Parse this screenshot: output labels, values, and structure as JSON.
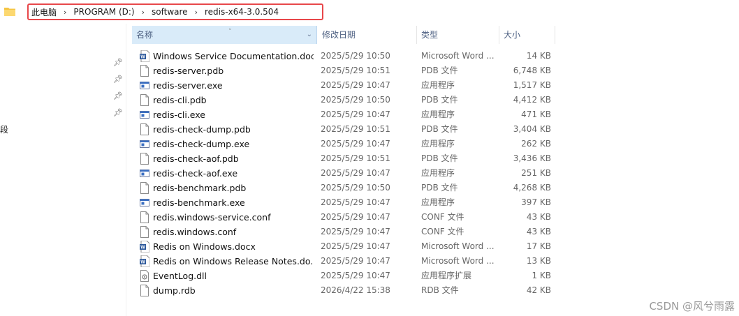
{
  "breadcrumb": [
    "此电脑",
    "PROGRAM (D:)",
    "software",
    "redis-x64-3.0.504"
  ],
  "nav_fragment": "段",
  "columns": {
    "name": "名称",
    "date": "修改日期",
    "type": "类型",
    "size": "大小"
  },
  "files": [
    {
      "name": "Windows Service Documentation.docx",
      "date": "2025/5/29 10:50",
      "type": "Microsoft Word ...",
      "size": "14 KB",
      "icon": "word-doc-icon"
    },
    {
      "name": "redis-server.pdb",
      "date": "2025/5/29 10:51",
      "type": "PDB 文件",
      "size": "6,748 KB",
      "icon": "file-icon"
    },
    {
      "name": "redis-server.exe",
      "date": "2025/5/29 10:47",
      "type": "应用程序",
      "size": "1,517 KB",
      "icon": "exe-icon"
    },
    {
      "name": "redis-cli.pdb",
      "date": "2025/5/29 10:50",
      "type": "PDB 文件",
      "size": "4,412 KB",
      "icon": "file-icon"
    },
    {
      "name": "redis-cli.exe",
      "date": "2025/5/29 10:47",
      "type": "应用程序",
      "size": "471 KB",
      "icon": "exe-icon"
    },
    {
      "name": "redis-check-dump.pdb",
      "date": "2025/5/29 10:51",
      "type": "PDB 文件",
      "size": "3,404 KB",
      "icon": "file-icon"
    },
    {
      "name": "redis-check-dump.exe",
      "date": "2025/5/29 10:47",
      "type": "应用程序",
      "size": "262 KB",
      "icon": "exe-icon"
    },
    {
      "name": "redis-check-aof.pdb",
      "date": "2025/5/29 10:51",
      "type": "PDB 文件",
      "size": "3,436 KB",
      "icon": "file-icon"
    },
    {
      "name": "redis-check-aof.exe",
      "date": "2025/5/29 10:47",
      "type": "应用程序",
      "size": "251 KB",
      "icon": "exe-icon"
    },
    {
      "name": "redis-benchmark.pdb",
      "date": "2025/5/29 10:50",
      "type": "PDB 文件",
      "size": "4,268 KB",
      "icon": "file-icon"
    },
    {
      "name": "redis-benchmark.exe",
      "date": "2025/5/29 10:47",
      "type": "应用程序",
      "size": "397 KB",
      "icon": "exe-icon"
    },
    {
      "name": "redis.windows-service.conf",
      "date": "2025/5/29 10:47",
      "type": "CONF 文件",
      "size": "43 KB",
      "icon": "file-icon"
    },
    {
      "name": "redis.windows.conf",
      "date": "2025/5/29 10:47",
      "type": "CONF 文件",
      "size": "43 KB",
      "icon": "file-icon"
    },
    {
      "name": "Redis on Windows.docx",
      "date": "2025/5/29 10:47",
      "type": "Microsoft Word ...",
      "size": "17 KB",
      "icon": "word-doc-icon"
    },
    {
      "name": "Redis on Windows Release Notes.do...",
      "date": "2025/5/29 10:47",
      "type": "Microsoft Word ...",
      "size": "13 KB",
      "icon": "word-doc-icon"
    },
    {
      "name": "EventLog.dll",
      "date": "2025/5/29 10:47",
      "type": "应用程序扩展",
      "size": "1 KB",
      "icon": "dll-icon"
    },
    {
      "name": "dump.rdb",
      "date": "2026/4/22 15:38",
      "type": "RDB 文件",
      "size": "42 KB",
      "icon": "file-icon"
    }
  ],
  "watermark": "CSDN @风兮雨露",
  "colors": {
    "highlight_border": "#e8474a",
    "header_selected": "#d9ebf9",
    "folder": "#f5c542",
    "word_blue": "#2b579a"
  }
}
